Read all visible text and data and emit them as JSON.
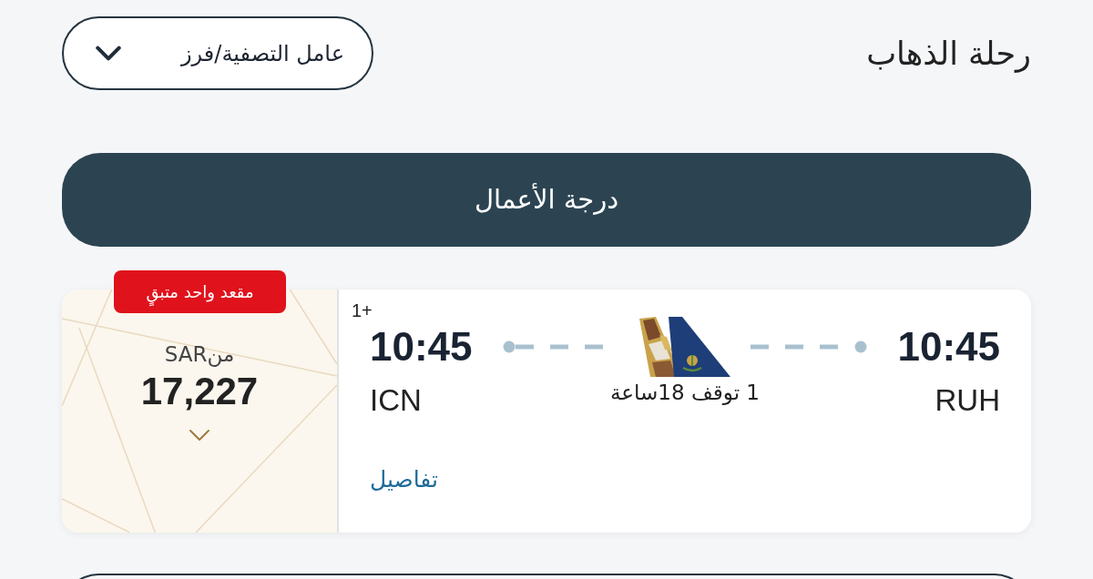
{
  "header": {
    "title": "رحلة الذهاب",
    "filter_button": "عامل التصفية/فرز"
  },
  "cabin_bar": {
    "label": "درجة الأعمال"
  },
  "flights": [
    {
      "departure": {
        "time": "10:45",
        "airport": "RUH"
      },
      "arrival": {
        "time": "10:45",
        "airport": "ICN",
        "day_offset": "1+"
      },
      "stops": "1 توقف 18ساعة",
      "details_link": "تفاصيل",
      "price": {
        "badge": "مقعد واحد متبقٍ",
        "prefix": "منSAR",
        "amount": "17,227",
        "expanded": false
      }
    }
  ]
}
